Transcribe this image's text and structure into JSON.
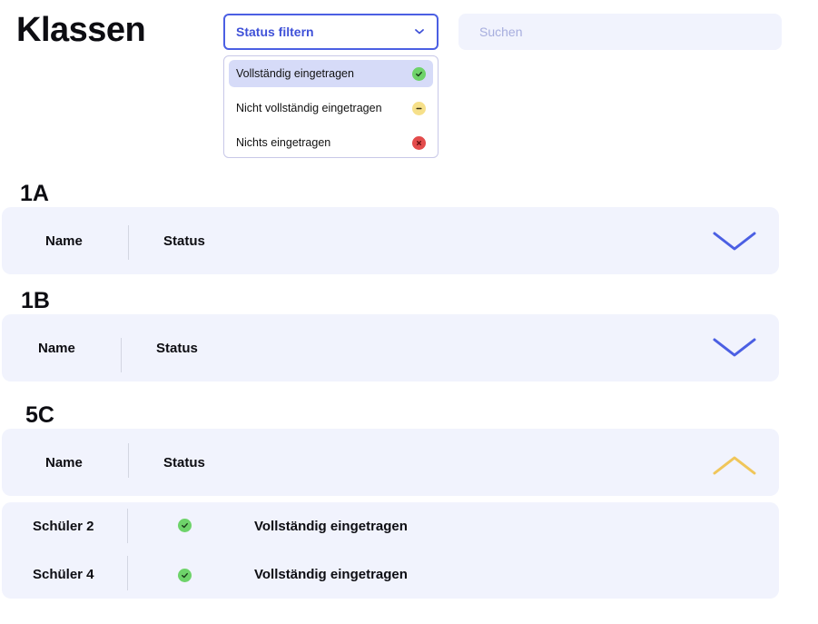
{
  "page": {
    "title": "Klassen"
  },
  "filter": {
    "label": "Status filtern",
    "icon": "chevron-down-icon",
    "options": [
      {
        "label": "Vollständig eingetragen",
        "status": "complete",
        "color": "#6ed36a",
        "icon": "check-icon",
        "selected": true
      },
      {
        "label": "Nicht vollständig eingetragen",
        "status": "partial",
        "color": "#f6e08a",
        "icon": "minus-icon",
        "selected": false
      },
      {
        "label": "Nichts eingetragen",
        "status": "none",
        "color": "#e34c4c",
        "icon": "x-icon",
        "selected": false
      }
    ]
  },
  "search": {
    "placeholder": "Suchen",
    "value": ""
  },
  "colors": {
    "accent": "#4b5fe3",
    "bar_bg": "#f1f3fd",
    "expanded_toggle": "#f0c65a",
    "complete": "#6ed36a"
  },
  "classes": [
    {
      "name": "1A",
      "col_name": "Name",
      "col_status": "Status",
      "expanded": false
    },
    {
      "name": "1B",
      "col_name": "Name",
      "col_status": "Status",
      "expanded": false
    },
    {
      "name": "5C",
      "col_name": "Name",
      "col_status": "Status",
      "expanded": true,
      "students": [
        {
          "name": "Schüler 2",
          "status": "Vollständig eingetragen"
        },
        {
          "name": "Schüler 4",
          "status": "Vollständig eingetragen"
        }
      ]
    }
  ]
}
